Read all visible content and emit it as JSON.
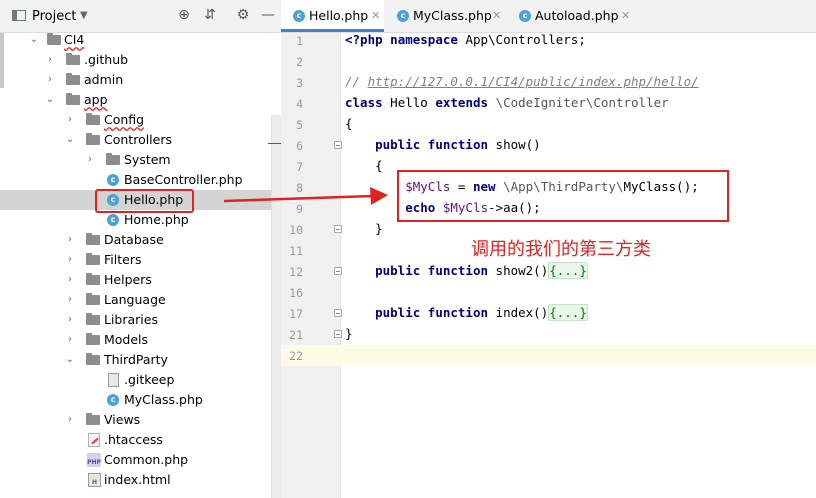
{
  "project_panel": {
    "title": "Project",
    "tree": [
      {
        "label": "CI4",
        "type": "folder"
      },
      {
        "label": ".github",
        "type": "folder"
      },
      {
        "label": "admin",
        "type": "folder"
      },
      {
        "label": "app",
        "type": "folder"
      },
      {
        "label": "Config",
        "type": "folder"
      },
      {
        "label": "Controllers",
        "type": "folder"
      },
      {
        "label": "System",
        "type": "folder"
      },
      {
        "label": "BaseController.php",
        "type": "class-file"
      },
      {
        "label": "Hello.php",
        "type": "class-file"
      },
      {
        "label": "Home.php",
        "type": "class-file"
      },
      {
        "label": "Database",
        "type": "folder"
      },
      {
        "label": "Filters",
        "type": "folder"
      },
      {
        "label": "Helpers",
        "type": "folder"
      },
      {
        "label": "Language",
        "type": "folder"
      },
      {
        "label": "Libraries",
        "type": "folder"
      },
      {
        "label": "Models",
        "type": "folder"
      },
      {
        "label": "ThirdParty",
        "type": "folder"
      },
      {
        "label": ".gitkeep",
        "type": "file"
      },
      {
        "label": "MyClass.php",
        "type": "class-file"
      },
      {
        "label": "Views",
        "type": "folder"
      },
      {
        "label": ".htaccess",
        "type": "file"
      },
      {
        "label": "Common.php",
        "type": "php-file"
      },
      {
        "label": "index.html",
        "type": "html-file"
      }
    ]
  },
  "tabs": [
    {
      "label": "Hello.php",
      "active": true
    },
    {
      "label": "MyClass.php",
      "active": false
    },
    {
      "label": "Autoload.php",
      "active": false
    }
  ],
  "gutter": {
    "line_numbers": [
      "1",
      "2",
      "3",
      "4",
      "5",
      "6",
      "7",
      "8",
      "9",
      "10",
      "11",
      "12",
      "16",
      "17",
      "21",
      "22"
    ]
  },
  "code": {
    "l1_a": "<?php",
    "l1_b": "namespace",
    "l1_c": "App\\Controllers;",
    "l3": "// ",
    "l3_url": "http://127.0.0.1/CI4/public/index.php/hello/",
    "l4_class": "class",
    "l4_name": "Hello",
    "l4_extends": "extends",
    "l4_base": "\\CodeIgniter\\Controller",
    "l5": "{",
    "l6_public": "public",
    "l6_function": "function",
    "l6_name": "show()",
    "l7": "{",
    "l8_var": "$MyCls",
    "l8_eq": " = ",
    "l8_new": "new",
    "l8_ns": "\\App\\ThirdParty\\",
    "l8_cls": "MyClass();",
    "l9_echo": "echo",
    "l9_var": "$MyCls",
    "l9_rest": "->aa();",
    "l10": "}",
    "l12_public": "public",
    "l12_function": "function",
    "l12_name": "show2()",
    "l12_fold": "{...}",
    "l17_public": "public",
    "l17_function": "function",
    "l17_name": "index()",
    "l17_fold": "{...}",
    "l21": "}"
  },
  "annotation": {
    "note": "调用的我们的第三方类",
    "color": "#e12222"
  }
}
